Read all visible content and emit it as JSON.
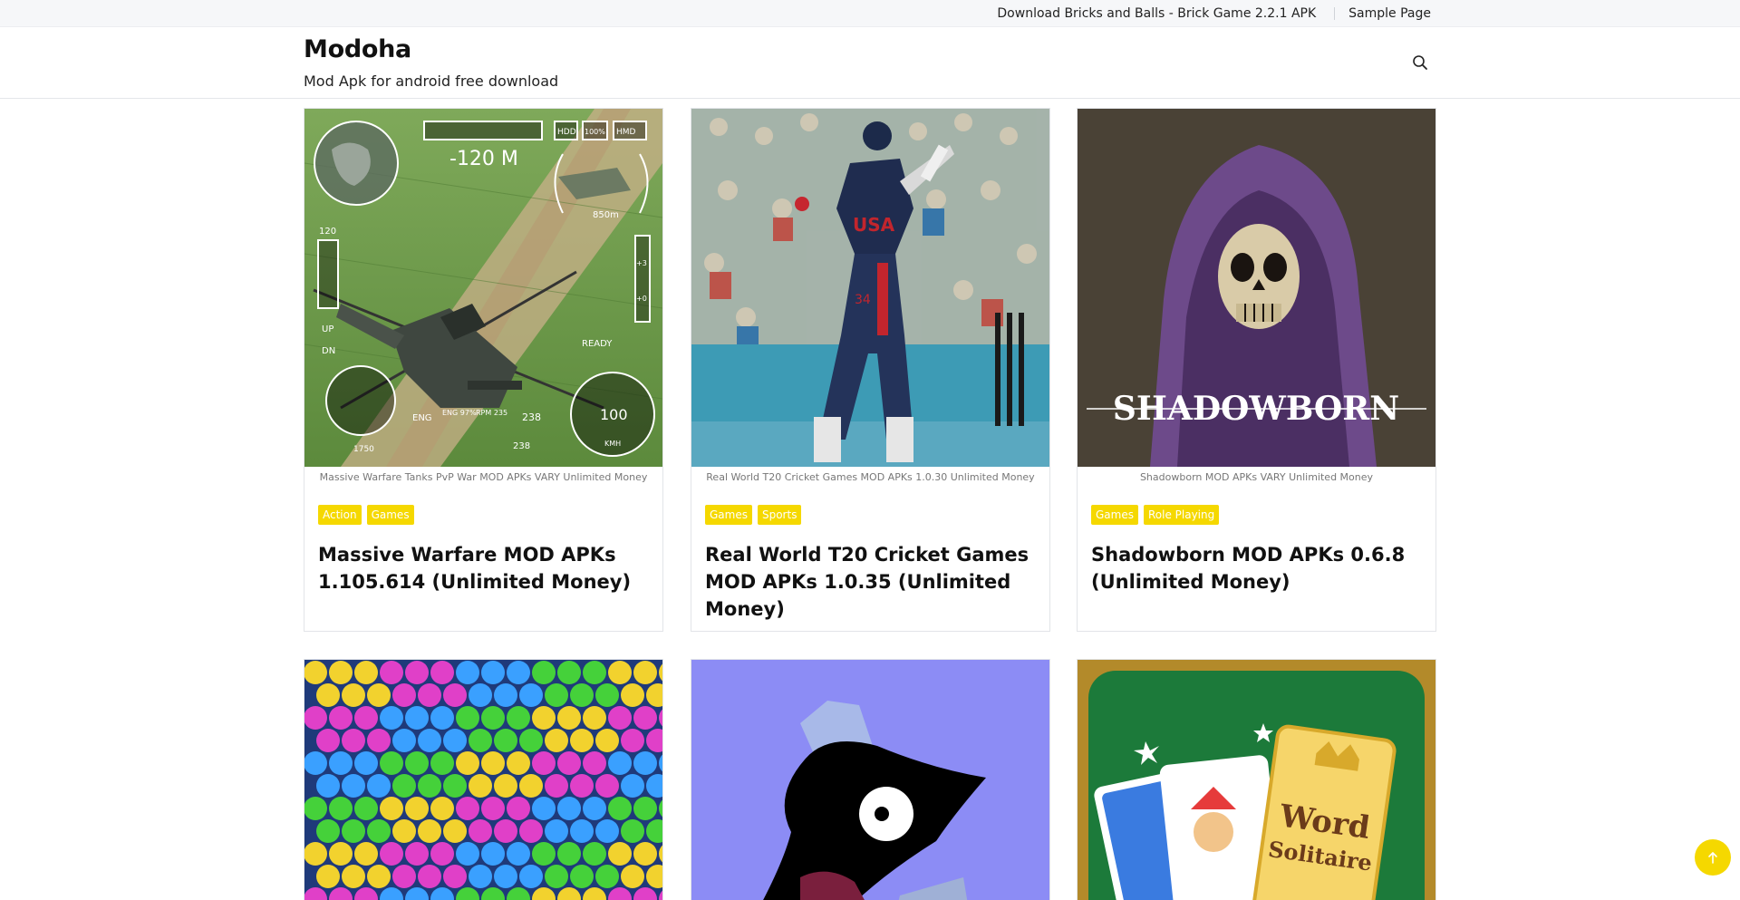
{
  "topbar": {
    "links": [
      "Download Bricks and Balls - Brick Game 2.2.1 APK",
      "Sample Page"
    ]
  },
  "header": {
    "site_title": "Modoha",
    "tagline": "Mod Apk for android free download",
    "search_icon": "search-icon"
  },
  "posts": [
    {
      "caption": "Massive Warfare Tanks PvP War MOD APKs VARY Unlimited Money",
      "tags": [
        "Action",
        "Games"
      ],
      "title": "Massive Warfare MOD APKs 1.105.614 (Unlimited Money)",
      "hud": {
        "altitude": "-120 M",
        "distance": "850m",
        "left_scale": "120",
        "up": "UP",
        "dn": "DN",
        "ready": "READY",
        "eng": "ENG",
        "eng2": "ENG 97%",
        "rpm": "RPM 235",
        "heading": "238",
        "speed": "100",
        "speed_unit": "KMH",
        "alt_small": "1750",
        "hdd": "HDD",
        "pct": "100%",
        "hmd": "HMD",
        "right_plus": "+3",
        "right_zero": "+0",
        "bottom_val": "238"
      }
    },
    {
      "caption": "Real World T20 Cricket Games MOD APKs 1.0.30 Unlimited Money",
      "tags": [
        "Games",
        "Sports"
      ],
      "title": "Real World T20 Cricket Games MOD APKs 1.0.35 (Unlimited Money)",
      "jersey": "USA",
      "number": "34"
    },
    {
      "caption": "Shadowborn MOD APKs VARY Unlimited Money",
      "tags": [
        "Games",
        "Role Playing"
      ],
      "title": "Shadowborn MOD APKs 0.6.8 (Unlimited Money)",
      "logo": "SHADOWBORN"
    },
    {
      "image": "bubble-shooter-art"
    },
    {
      "image": "purple-bird-art"
    },
    {
      "image": "word-solitaire-art",
      "logo_line1": "Word",
      "logo_line2": "Solitaire"
    }
  ],
  "scroll_top_icon": "arrow-up-icon",
  "colors": {
    "tag": "#f5d800",
    "scroll_button": "#f5d800"
  }
}
